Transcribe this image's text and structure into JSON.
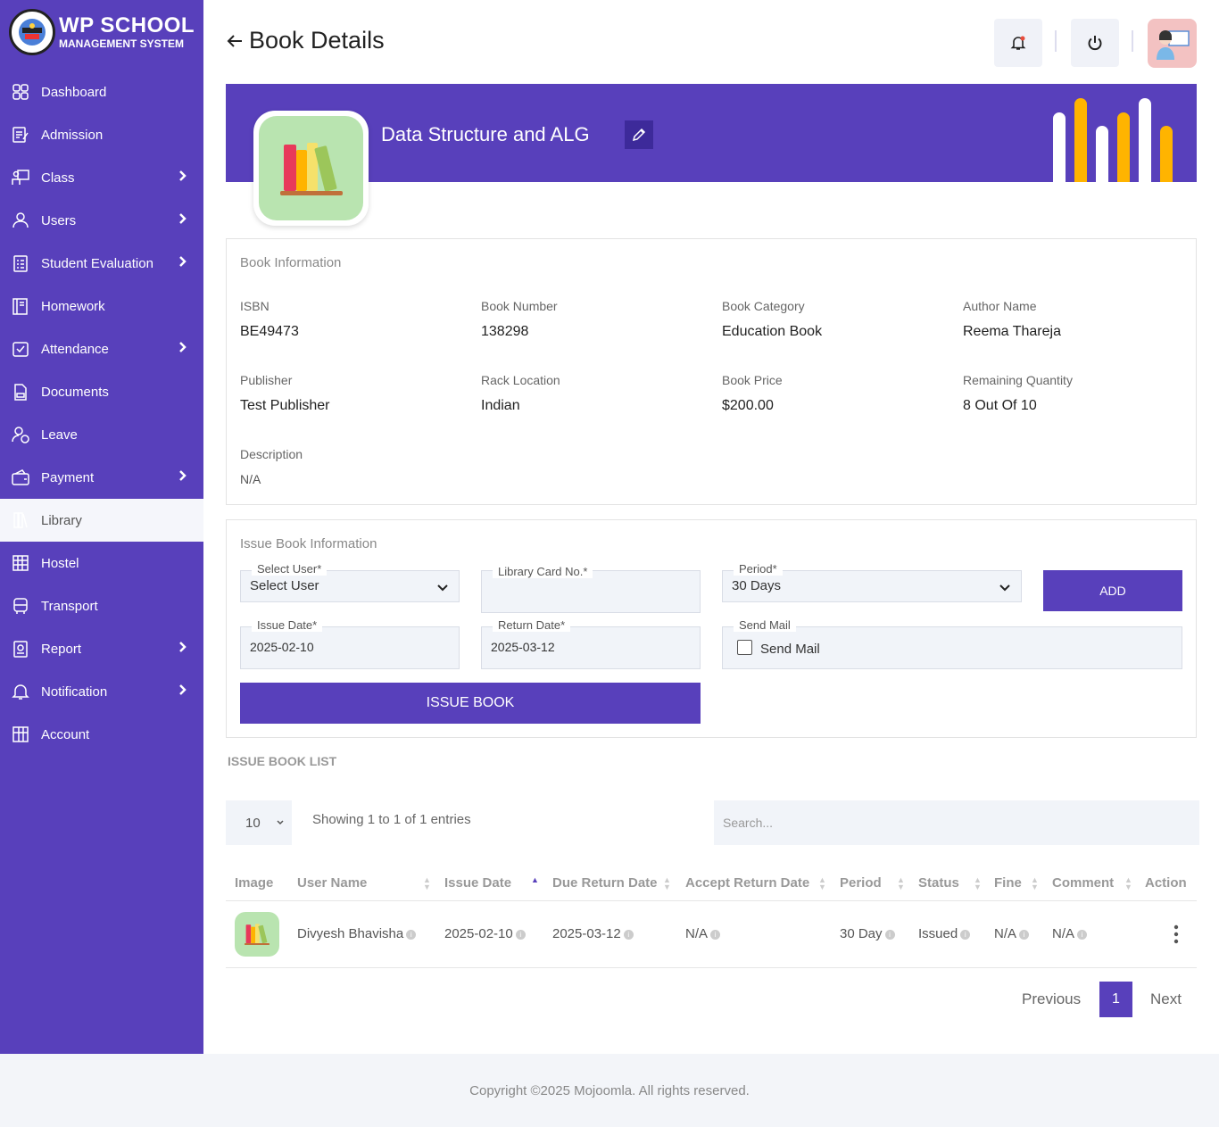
{
  "brand": {
    "title": "WP SCHOOL",
    "subtitle": "MANAGEMENT SYSTEM"
  },
  "sidebar": {
    "items": [
      {
        "label": "Dashboard",
        "icon": "dashboard-icon",
        "chevron": false
      },
      {
        "label": "Admission",
        "icon": "admission-icon",
        "chevron": false
      },
      {
        "label": "Class",
        "icon": "class-icon",
        "chevron": true
      },
      {
        "label": "Users",
        "icon": "user-icon",
        "chevron": true
      },
      {
        "label": "Student Evaluation",
        "icon": "evaluation-icon",
        "chevron": true
      },
      {
        "label": "Homework",
        "icon": "homework-icon",
        "chevron": false
      },
      {
        "label": "Attendance",
        "icon": "attendance-icon",
        "chevron": true
      },
      {
        "label": "Documents",
        "icon": "documents-icon",
        "chevron": false
      },
      {
        "label": "Leave",
        "icon": "leave-icon",
        "chevron": false
      },
      {
        "label": "Payment",
        "icon": "payment-icon",
        "chevron": true
      },
      {
        "label": "Library",
        "icon": "library-icon",
        "chevron": false,
        "active": true
      },
      {
        "label": "Hostel",
        "icon": "hostel-icon",
        "chevron": false
      },
      {
        "label": "Transport",
        "icon": "bus-icon",
        "chevron": false
      },
      {
        "label": "Report",
        "icon": "report-icon",
        "chevron": true
      },
      {
        "label": "Notification",
        "icon": "bell-icon",
        "chevron": true
      },
      {
        "label": "Account",
        "icon": "account-icon",
        "chevron": false
      }
    ]
  },
  "header": {
    "title": "Book Details"
  },
  "book": {
    "title": "Data Structure and ALG"
  },
  "book_info": {
    "section_title": "Book Information",
    "isbn_label": "ISBN",
    "isbn": "BE49473",
    "number_label": "Book Number",
    "number": "138298",
    "category_label": "Book Category",
    "category": "Education Book",
    "author_label": "Author Name",
    "author": "Reema Thareja",
    "publisher_label": "Publisher",
    "publisher": "Test Publisher",
    "rack_label": "Rack Location",
    "rack": "Indian",
    "price_label": "Book Price",
    "price": "$200.00",
    "remaining_label": "Remaining Quantity",
    "remaining": "8 Out Of 10",
    "description_label": "Description",
    "description": "N/A"
  },
  "issue_form": {
    "section_title": "Issue Book Information",
    "select_user_label": "Select User*",
    "select_user_value": "Select User",
    "card_label": "Library Card No.*",
    "card_value": "",
    "period_label": "Period*",
    "period_value": "30 Days",
    "add_label": "ADD",
    "issue_date_label": "Issue Date*",
    "issue_date": "2025-02-10",
    "return_date_label": "Return Date*",
    "return_date": "2025-03-12",
    "send_mail_label": "Send Mail",
    "send_mail_text": "Send Mail",
    "issue_button": "ISSUE BOOK"
  },
  "list": {
    "section_title": "ISSUE BOOK LIST",
    "page_length": "10",
    "showing": "Showing 1 to 1 of 1 entries",
    "search_placeholder": "Search...",
    "columns": [
      "Image",
      "User Name",
      "Issue Date",
      "Due Return Date",
      "Accept Return Date",
      "Period",
      "Status",
      "Fine",
      "Comment",
      "Action"
    ],
    "rows": [
      {
        "user": "Divyesh Bhavisha",
        "issue_date": "2025-02-10",
        "due_date": "2025-03-12",
        "accept_date": "N/A",
        "period": "30 Day",
        "status": "Issued",
        "fine": "N/A",
        "comment": "N/A"
      }
    ],
    "prev": "Previous",
    "page": "1",
    "next": "Next"
  },
  "footer": {
    "text": "Copyright ©2025 Mojoomla. All rights reserved."
  },
  "colors": {
    "primary": "#5840bb",
    "accent": "#ffb400",
    "book_bg": "#b9e4b0"
  }
}
